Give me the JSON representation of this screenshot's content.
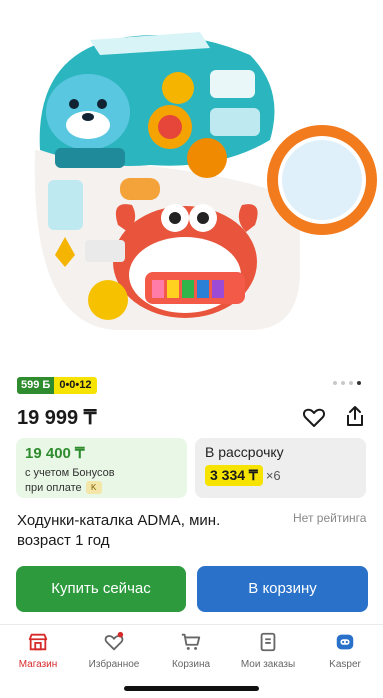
{
  "product": {
    "image_alt": "Ходунки-каталка ADMA",
    "badge_bonus": "599 Б",
    "badge_installment": "0•0•12",
    "carousel_total": 4,
    "carousel_active": 4,
    "price": "19 999 ₸",
    "bonus_card": {
      "amount": "19 400 ₸",
      "note_line1": "с учетом Бонусов",
      "note_line2": "при оплате",
      "chip": "K"
    },
    "installment_card": {
      "label": "В рассрочку",
      "monthly": "3 334 ₸",
      "times": "×6"
    },
    "title": "Ходунки-каталка ADMA, мин. возраст 1 год",
    "rating": "Нет рейтинга"
  },
  "actions": {
    "buy_label": "Купить сейчас",
    "cart_label": "В корзину"
  },
  "tabs": [
    {
      "label": "Магазин",
      "icon": "shop-icon",
      "active": true
    },
    {
      "label": "Избранное",
      "icon": "heart-icon",
      "active": false
    },
    {
      "label": "Корзина",
      "icon": "cart-icon",
      "active": false
    },
    {
      "label": "Мои заказы",
      "icon": "orders-icon",
      "active": false
    },
    {
      "label": "Kasper",
      "icon": "kasper-icon",
      "active": false
    }
  ],
  "colors": {
    "accent_green": "#2d9a3d",
    "accent_blue": "#2a72c9",
    "accent_red": "#d62b2b",
    "accent_yellow": "#f7e300"
  }
}
